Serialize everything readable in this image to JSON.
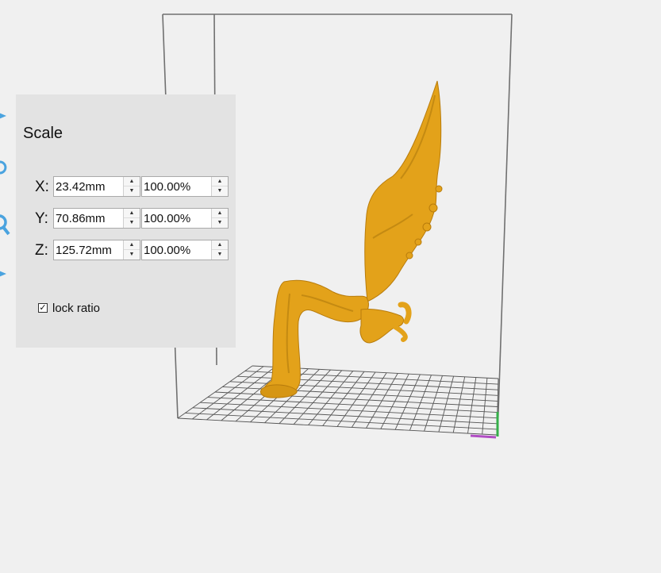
{
  "scale_panel": {
    "title": "Scale",
    "rows": [
      {
        "axis": "X:",
        "size": "23.42mm",
        "percent": "100.00%"
      },
      {
        "axis": "Y:",
        "size": "70.86mm",
        "percent": "100.00%"
      },
      {
        "axis": "Z:",
        "size": "125.72mm",
        "percent": "100.00%"
      }
    ],
    "lock_ratio_label": "lock ratio",
    "lock_ratio_checked": true
  },
  "toolbar_icons": [
    "move-icon",
    "rotate-icon",
    "scale-icon",
    "mirror-icon"
  ],
  "colors": {
    "model": "#e3a21a",
    "model_shadow": "#b87c0c",
    "panel": "#e3e3e3",
    "background": "#f0f0f0",
    "accent_icons": "#4aa3df",
    "axis_x": "#b14dc4",
    "axis_y": "#35b04a"
  }
}
